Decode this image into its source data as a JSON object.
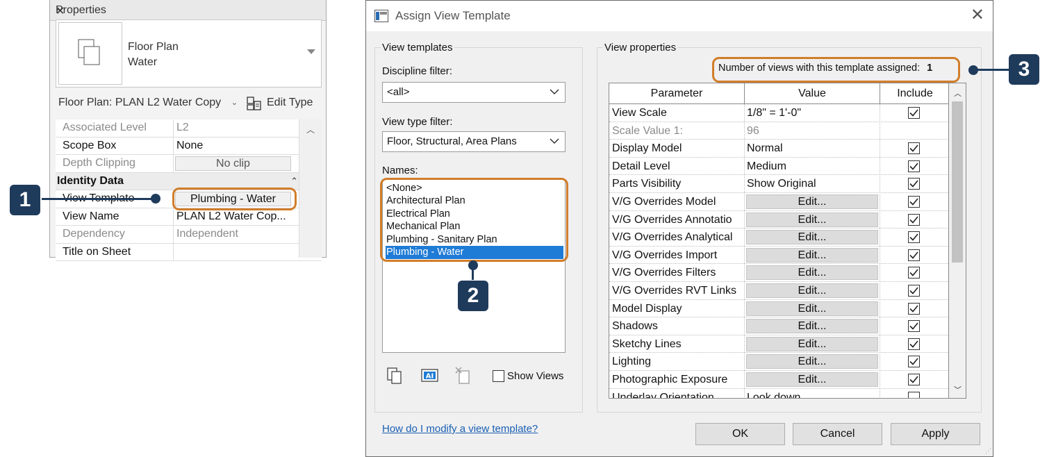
{
  "properties": {
    "title": "Properties",
    "type_name_line1": "Floor Plan",
    "type_name_line2": "Water",
    "instance_selector": "Floor Plan: PLAN L2 Water Copy",
    "edit_type_label": "Edit Type",
    "rows": [
      {
        "name": "Associated Level",
        "value": "L2"
      },
      {
        "name": "Scope Box",
        "value": "None"
      },
      {
        "name": "Depth Clipping",
        "value": "No clip"
      },
      {
        "name": "Identity Data",
        "value": ""
      },
      {
        "name": "View Template",
        "value": "Plumbing - Water"
      },
      {
        "name": "View Name",
        "value": "PLAN L2 Water Cop..."
      },
      {
        "name": "Dependency",
        "value": "Independent"
      },
      {
        "name": "Title on Sheet",
        "value": ""
      }
    ]
  },
  "callouts": {
    "c1": "1",
    "c2": "2",
    "c3": "3"
  },
  "dialog": {
    "title": "Assign View Template",
    "view_templates_group": "View templates",
    "discipline_filter_label": "Discipline filter:",
    "discipline_filter_value": "<all>",
    "view_type_filter_label": "View type filter:",
    "view_type_filter_value": "Floor, Structural, Area Plans",
    "names_label": "Names:",
    "names": [
      "<None>",
      "Architectural Plan",
      "Electrical Plan",
      "Mechanical Plan",
      "Plumbing - Sanitary Plan",
      "Plumbing - Water"
    ],
    "selected_name": "Plumbing - Water",
    "show_views_label": "Show Views",
    "view_properties_group": "View properties",
    "count_label": "Number of views with this template assigned:",
    "count_value": "1",
    "columns": {
      "parameter": "Parameter",
      "value": "Value",
      "include": "Include"
    },
    "rows": [
      {
        "parameter": "View Scale",
        "value": "1/8\" = 1'-0\"",
        "kind": "text",
        "include": true
      },
      {
        "parameter": "Scale Value    1:",
        "value": "96",
        "kind": "dim",
        "include": null
      },
      {
        "parameter": "Display Model",
        "value": "Normal",
        "kind": "text",
        "include": true
      },
      {
        "parameter": "Detail Level",
        "value": "Medium",
        "kind": "text",
        "include": true
      },
      {
        "parameter": "Parts Visibility",
        "value": "Show Original",
        "kind": "text",
        "include": true
      },
      {
        "parameter": "V/G Overrides Model",
        "value": "Edit...",
        "kind": "button",
        "include": true
      },
      {
        "parameter": "V/G Overrides Annotatio",
        "value": "Edit...",
        "kind": "button",
        "include": true
      },
      {
        "parameter": "V/G Overrides Analytical",
        "value": "Edit...",
        "kind": "button",
        "include": true
      },
      {
        "parameter": "V/G Overrides Import",
        "value": "Edit...",
        "kind": "button",
        "include": true
      },
      {
        "parameter": "V/G Overrides Filters",
        "value": "Edit...",
        "kind": "button",
        "include": true
      },
      {
        "parameter": "V/G Overrides RVT Links",
        "value": "Edit...",
        "kind": "button",
        "include": true
      },
      {
        "parameter": "Model Display",
        "value": "Edit...",
        "kind": "button",
        "include": true
      },
      {
        "parameter": "Shadows",
        "value": "Edit...",
        "kind": "button",
        "include": true
      },
      {
        "parameter": "Sketchy Lines",
        "value": "Edit...",
        "kind": "button",
        "include": true
      },
      {
        "parameter": "Lighting",
        "value": "Edit...",
        "kind": "button",
        "include": true
      },
      {
        "parameter": "Photographic Exposure",
        "value": "Edit...",
        "kind": "button",
        "include": true
      },
      {
        "parameter": "Underlay Orientation",
        "value": "Look down",
        "kind": "text",
        "include": false
      }
    ],
    "help_link": "How do I modify a view template?",
    "ok_label": "OK",
    "cancel_label": "Cancel",
    "apply_label": "Apply"
  },
  "colors": {
    "callout": "#1f3b5c",
    "highlight": "#d17d2a",
    "selection": "#1e7bd6",
    "link": "#1a5fb4"
  }
}
